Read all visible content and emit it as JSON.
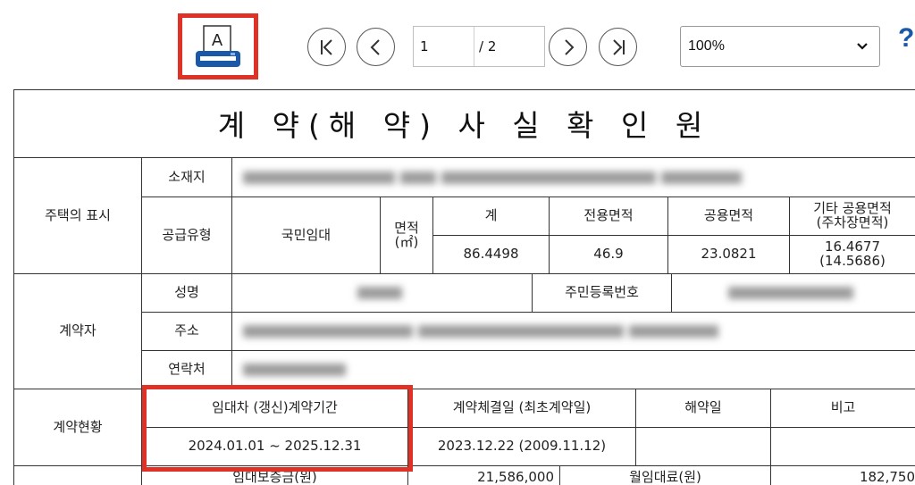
{
  "toolbar": {
    "icons": {
      "print": "print-icon",
      "first": "first-page-icon",
      "prev": "prev-page-icon",
      "next": "next-page-icon",
      "last": "last-page-icon",
      "help": "help-icon",
      "dropdown": "chevron-down-icon"
    },
    "print_glyph": "A",
    "current_page": "1",
    "total_pages": "/ 2",
    "zoom": "100%",
    "help_label": "?",
    "highlight_color": "#e03127",
    "accent_color": "#1a59a8"
  },
  "document": {
    "title": "계 약(해 약) 사 실 확 인 원",
    "housing": {
      "section_label": "주택의 표시",
      "location_label": "소재지",
      "supply_type_label": "공급유형",
      "supply_type_value": "국민임대",
      "area_label": "면적",
      "area_unit": "(㎡)",
      "columns": [
        "계",
        "전용면적",
        "공용면적"
      ],
      "other_area_label_1": "기타 공용면적",
      "other_area_label_2": "(주차장면적)",
      "total_area": "86.4498",
      "exclusive_area": "46.9",
      "common_area": "23.0821",
      "other_area": "16.4677",
      "parking_area": "(14.5686)"
    },
    "contractor": {
      "section_label": "계약자",
      "name_label": "성명",
      "resident_no_label": "주민등록번호",
      "address_label": "주소",
      "contact_label": "연락처"
    },
    "contract_status": {
      "section_label": "계약현황",
      "period_label": "임대차 (갱신)계약기간",
      "signed_label": "계약체결일 (최초계약일)",
      "termination_label": "해약일",
      "note_label": "비고",
      "period_value": "2024.01.01 ~ 2025.12.31",
      "signed_value": "2023.12.22 (2009.11.12)"
    },
    "rent": {
      "deposit_label": "임대보증금(원)",
      "deposit_value": "21,586,000",
      "monthly_label": "월임대료(원)",
      "monthly_value": "182,750"
    }
  }
}
